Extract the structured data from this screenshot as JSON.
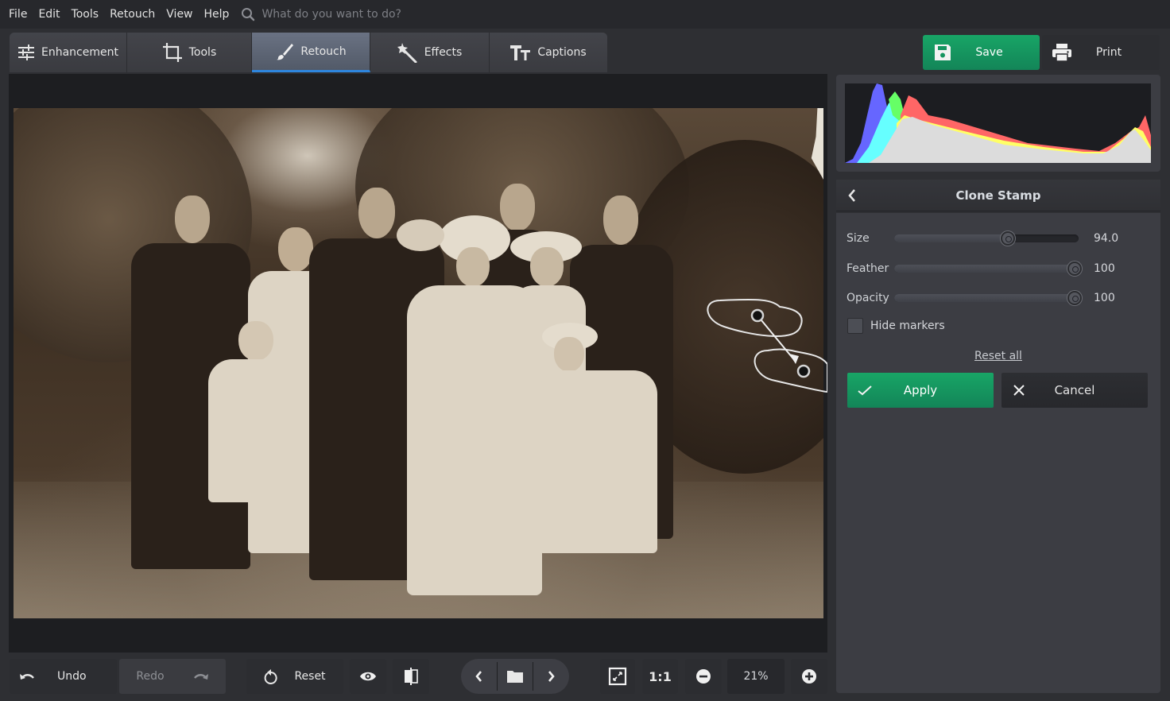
{
  "menu": {
    "items": [
      "File",
      "Edit",
      "Tools",
      "Retouch",
      "View",
      "Help"
    ],
    "search_placeholder": "What do you want to do?"
  },
  "tabs": [
    {
      "label": "Enhancement",
      "icon": "sliders-icon",
      "active": false
    },
    {
      "label": "Tools",
      "icon": "crop-icon",
      "active": false
    },
    {
      "label": "Retouch",
      "icon": "brush-icon",
      "active": true
    },
    {
      "label": "Effects",
      "icon": "magic-wand-icon",
      "active": false
    },
    {
      "label": "Captions",
      "icon": "text-icon",
      "active": false
    }
  ],
  "header_actions": {
    "save_label": "Save",
    "print_label": "Print"
  },
  "colors": {
    "accent_green": "#16a062",
    "active_tab_underline": "#2e86de",
    "histogram": [
      "#6666ff",
      "#66ffff",
      "#66ff66",
      "#ff6666",
      "#ffff66",
      "#dcdcdc"
    ]
  },
  "panel": {
    "title": "Clone Stamp",
    "sliders": [
      {
        "label": "Size",
        "value": "94.0",
        "fraction": 0.62
      },
      {
        "label": "Feather",
        "value": "100",
        "fraction": 1.0
      },
      {
        "label": "Opacity",
        "value": "100",
        "fraction": 1.0
      }
    ],
    "hide_markers_label": "Hide markers",
    "hide_markers_checked": false,
    "reset_all_label": "Reset all",
    "apply_label": "Apply",
    "cancel_label": "Cancel"
  },
  "bottom": {
    "undo_label": "Undo",
    "redo_label": "Redo",
    "reset_label": "Reset",
    "one_to_one_label": "1:1",
    "zoom_value": "21%"
  }
}
